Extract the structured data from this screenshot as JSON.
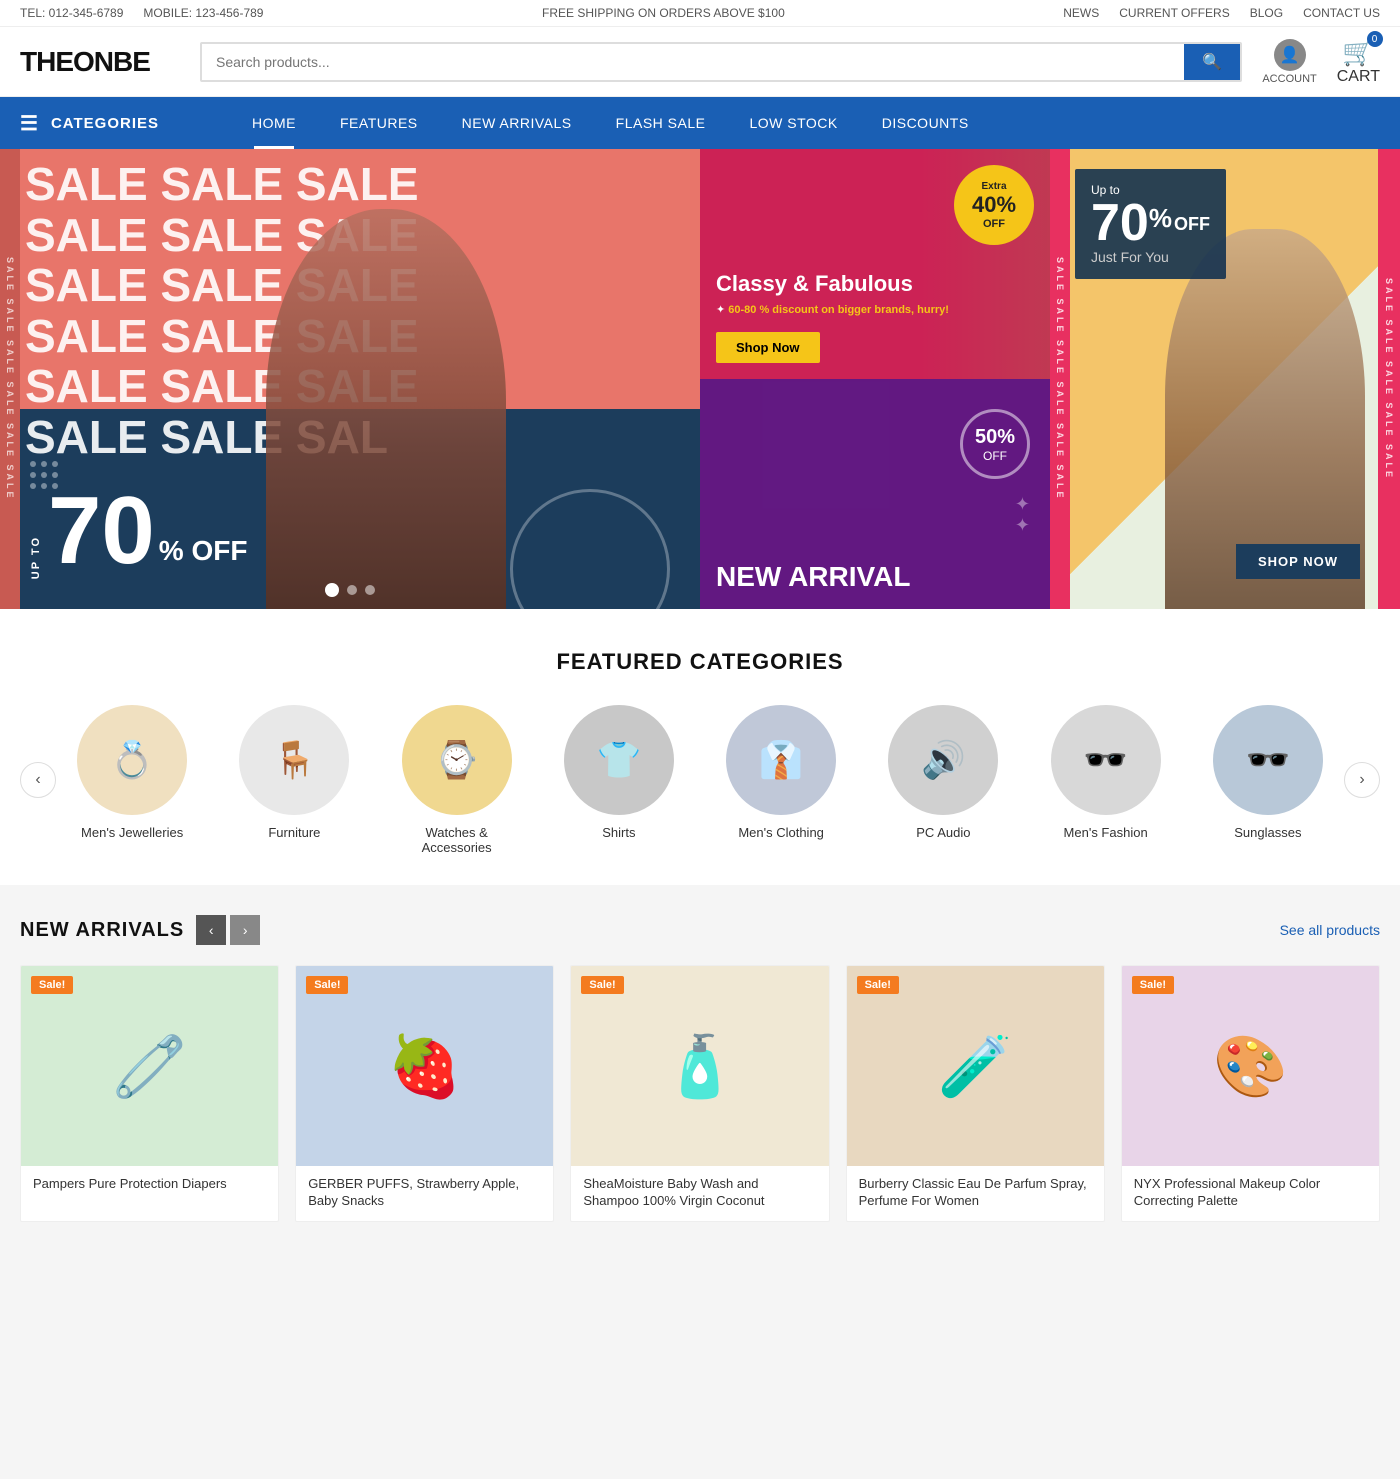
{
  "topbar": {
    "tel": "TEL: 012-345-6789",
    "mobile": "MOBILE: 123-456-789",
    "promo": "FREE SHIPPING ON ORDERS ABOVE $100",
    "links": [
      "NEWS",
      "CURRENT OFFERS",
      "BLOG",
      "CONTACT US"
    ]
  },
  "header": {
    "logo": "THEONBE",
    "search_placeholder": "Search products...",
    "account_label": "ACCOUNT",
    "cart_label": "CART",
    "cart_count": "0"
  },
  "nav": {
    "categories_label": "CATEGORIES",
    "links": [
      {
        "label": "HOME",
        "active": true
      },
      {
        "label": "FEATURES",
        "active": false
      },
      {
        "label": "NEW ARRIVALS",
        "active": false
      },
      {
        "label": "FLASH SALE",
        "active": false
      },
      {
        "label": "LOW STOCK",
        "active": false
      },
      {
        "label": "DISCOUNTS",
        "active": false
      }
    ]
  },
  "hero": {
    "main_sale_text": "SALE SALE SALE SALE SALE SALE SALE SALE SALE SALE SALE SALE SALE SALE SALE SALE",
    "main_upto": "UP TO",
    "main_percent": "70",
    "main_off": "% OFF",
    "slide1_active": true,
    "carousel_dots": [
      "active",
      "",
      ""
    ]
  },
  "side_top": {
    "extra": "Extra",
    "pct": "40%",
    "off": "OFF",
    "title": "Classy & Fabulous",
    "sub": "60-80 % discount on bigger brands, hurry!",
    "btn": "Shop Now"
  },
  "side_bottom": {
    "title": "NEW ARRIVAL",
    "badge_pct": "50%",
    "badge_off": "OFF"
  },
  "right_banner": {
    "upto": "Up to",
    "big": "70",
    "pct": "%",
    "off": "OFF",
    "sub": "Just For You",
    "btn": "SHOP NOW",
    "sale_vertical": "SALE SALE SALE SALE SALE"
  },
  "featured_categories": {
    "title": "FEATURED CATEGORIES",
    "items": [
      {
        "label": "Men's Jewelleries",
        "icon": "💍"
      },
      {
        "label": "Furniture",
        "icon": "🪑"
      },
      {
        "label": "Watches & Accessories",
        "icon": "⌚"
      },
      {
        "label": "Shirts",
        "icon": "👕"
      },
      {
        "label": "Men's Clothing",
        "icon": "👔"
      },
      {
        "label": "PC Audio",
        "icon": "🔊"
      },
      {
        "label": "Men's Fashion",
        "icon": "🕶️"
      },
      {
        "label": "Sunglasses",
        "icon": "🕶️"
      }
    ]
  },
  "new_arrivals": {
    "title": "NEW ARRIVALS",
    "see_all": "See all products",
    "products": [
      {
        "name": "Pampers Pure Protection Diapers",
        "badge": "Sale!",
        "bg": "#d4ecd4"
      },
      {
        "name": "GERBER PUFFS, Strawberry Apple, Baby Snacks",
        "badge": "Sale!",
        "bg": "#c4d4e8"
      },
      {
        "name": "SheaMoisture Baby Wash and Shampoo 100% Virgin Coconut",
        "badge": "Sale!",
        "bg": "#f0e8d4"
      },
      {
        "name": "Burberry Classic Eau De Parfum Spray, Perfume For Women",
        "badge": "Sale!",
        "bg": "#e8d8c0"
      },
      {
        "name": "NYX Professional Makeup Color Correcting Palette",
        "badge": "Sale!",
        "bg": "#e8d4e8"
      }
    ]
  }
}
